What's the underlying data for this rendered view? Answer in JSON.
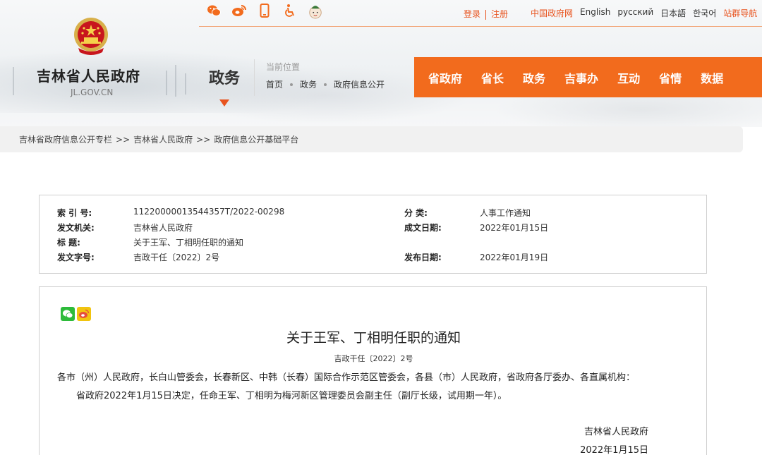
{
  "header": {
    "site_name": "吉林省人民政府",
    "site_domain": "JL.GOV.CN",
    "section_title": "政务",
    "top_icons": [
      "weibo-icon",
      "weibo-alt-icon",
      "mobile-icon",
      "accessibility-icon",
      "mascot-icon"
    ],
    "login": "登录",
    "register": "注册",
    "links": [
      "中国政府网",
      "English",
      "русский",
      "日本語",
      "한국어",
      "站群导航"
    ]
  },
  "location": {
    "label": "当前位置",
    "path": [
      "首页",
      "政务",
      "政府信息公开"
    ]
  },
  "main_nav": [
    "省政府",
    "省长",
    "政务",
    "吉事办",
    "互动",
    "省情",
    "数据"
  ],
  "breadcrumb": [
    "吉林省政府信息公开专栏",
    "吉林省人民政府",
    "政府信息公开基础平台"
  ],
  "breadcrumb_sep": ">>",
  "meta": {
    "index_label": "索 引 号:",
    "index_value": "11220000013544357T/2022-00298",
    "category_label": "分    类:",
    "category_value": "人事工作通知",
    "issuer_label": "发文机关:",
    "issuer_value": "吉林省人民政府",
    "date_written_label": "成文日期:",
    "date_written_value": "2022年01月15日",
    "title_label": "标    题:",
    "title_value": "关于王军、丁相明任职的通知",
    "docno_label": "发文字号:",
    "docno_value": "吉政干任〔2022〕2号",
    "date_published_label": "发布日期:",
    "date_published_value": "2022年01月19日"
  },
  "article": {
    "title": "关于王军、丁相明任职的通知",
    "doc_number": "吉政干任〔2022〕2号",
    "recipients": "各市（州）人民政府，长白山管委会，长春新区、中韩（长春）国际合作示范区管委会，各县（市）人民政府，省政府各厅委办、各直属机构：",
    "body": "省政府2022年1月15日决定，任命王军、丁相明为梅河新区管理委员会副主任（副厅长级，试用期一年）。",
    "signature_org": "吉林省人民政府",
    "signature_date": "2022年1月15日"
  },
  "colors": {
    "accent": "#f26b1d",
    "accent_text": "#e8531e"
  }
}
